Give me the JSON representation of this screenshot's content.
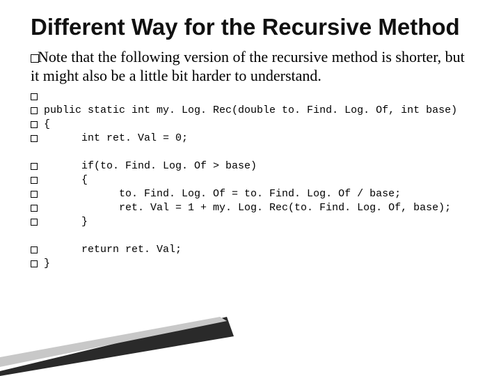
{
  "title": "Different Way for the Recursive Method",
  "body_lead": "Note that the following version of the recursive method is shorter, but it might also be a little bit harder to understand.",
  "code": {
    "l1": "",
    "l2": "public static int my. Log. Rec(double to. Find. Log. Of, int base)",
    "l3": "{",
    "l4": "      int ret. Val = 0;",
    "l5": "      if(to. Find. Log. Of > base)",
    "l6": "      {",
    "l7": "            to. Find. Log. Of = to. Find. Log. Of / base;",
    "l8": "            ret. Val = 1 + my. Log. Rec(to. Find. Log. Of, base);",
    "l9": "      }",
    "l10": "      return ret. Val;",
    "l11": "}"
  }
}
